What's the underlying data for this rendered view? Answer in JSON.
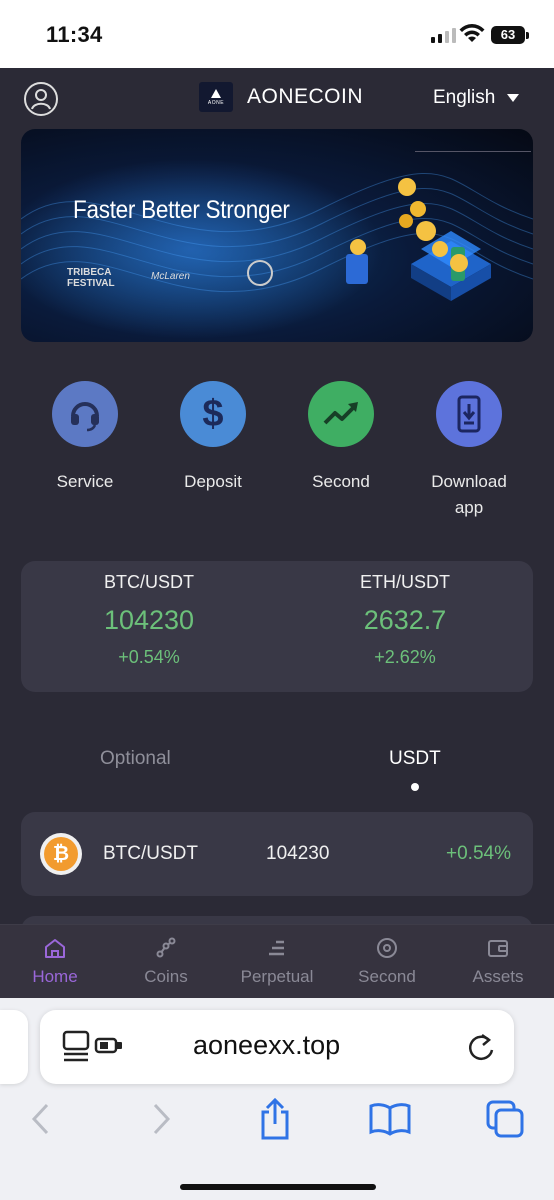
{
  "status_bar": {
    "time": "11:34",
    "battery": "63"
  },
  "header": {
    "brand_logo_text": "AONE",
    "brand_name": "AONECOIN",
    "language": "English"
  },
  "banner": {
    "tagline": "Faster Better Stronger",
    "partners": [
      "TRIBECA FESTIVAL",
      "McLaren"
    ]
  },
  "actions": [
    {
      "label": "Service",
      "icon": "headset-icon"
    },
    {
      "label": "Deposit",
      "icon": "dollar-icon"
    },
    {
      "label": "Second",
      "icon": "trend-up-icon"
    },
    {
      "label": "Download app",
      "icon": "phone-download-icon"
    }
  ],
  "tickers": [
    {
      "pair": "BTC/USDT",
      "price": "104230",
      "change": "+0.54%"
    },
    {
      "pair": "ETH/USDT",
      "price": "2632.7",
      "change": "+2.62%"
    }
  ],
  "market_tabs": {
    "optional": "Optional",
    "usdt": "USDT",
    "active": "USDT"
  },
  "market_list": [
    {
      "pair": "BTC/USDT",
      "price": "104230",
      "change": "+0.54%",
      "icon": "bitcoin-icon"
    }
  ],
  "bottom_nav": {
    "active": "Home",
    "items": [
      {
        "label": "Home",
        "icon": "home-icon"
      },
      {
        "label": "Coins",
        "icon": "coins-icon"
      },
      {
        "label": "Perpetual",
        "icon": "perpetual-icon"
      },
      {
        "label": "Second",
        "icon": "target-icon"
      },
      {
        "label": "Assets",
        "icon": "wallet-icon"
      }
    ]
  },
  "browser": {
    "url": "aoneexx.top"
  },
  "colors": {
    "background": "#2b2a36",
    "card": "#393846",
    "positive": "#6cc07a",
    "accent": "#9a67d9"
  }
}
